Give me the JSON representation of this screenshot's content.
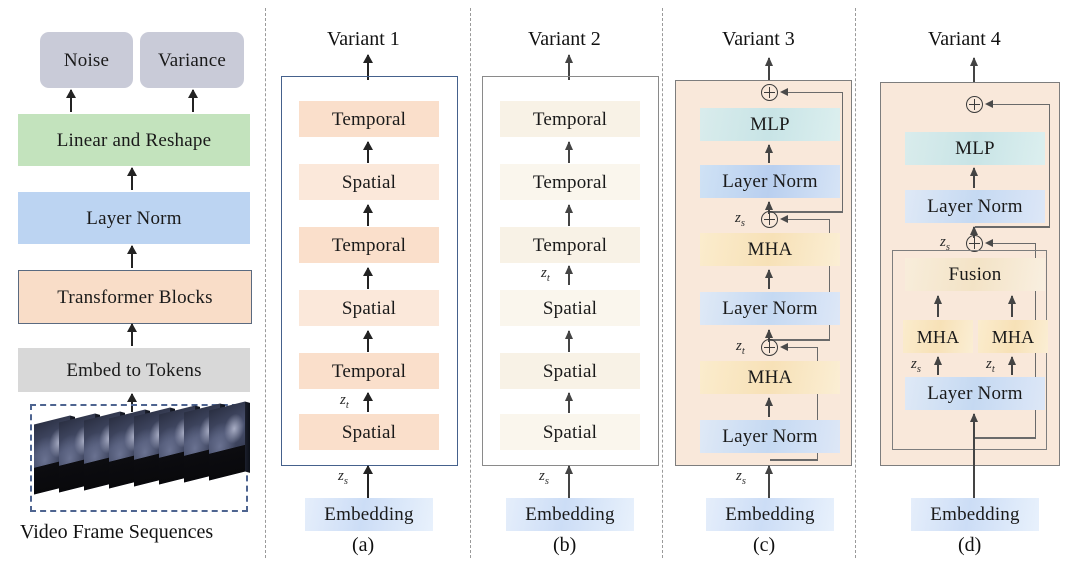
{
  "figure": {
    "left_pipeline": {
      "outputs": [
        {
          "label": "Noise"
        },
        {
          "label": "Variance"
        }
      ],
      "stages": [
        {
          "label": "Linear and Reshape",
          "color": "#c3e3bd"
        },
        {
          "label": "Layer Norm",
          "color": "#bcd4f2"
        },
        {
          "label": "Transformer Blocks",
          "color": "#f9ddc8"
        },
        {
          "label": "Embed to Tokens",
          "color": "#d8d8d8"
        }
      ],
      "input_caption": "Video Frame Sequences",
      "frame_count": 8
    },
    "variants": [
      {
        "title": "Variant 1",
        "caption": "(a)",
        "embedding_label": "Embedding",
        "input_token": "z_s",
        "mid_token": "z_t",
        "border_color": "#45618c",
        "blocks": [
          {
            "label": "Temporal"
          },
          {
            "label": "Spatial"
          },
          {
            "label": "Temporal"
          },
          {
            "label": "Spatial"
          },
          {
            "label": "Temporal"
          },
          {
            "label": "Spatial"
          }
        ]
      },
      {
        "title": "Variant 2",
        "caption": "(b)",
        "embedding_label": "Embedding",
        "input_token": "z_s",
        "mid_token": "z_t",
        "border_color": "#8a8a8a",
        "blocks": [
          {
            "label": "Temporal"
          },
          {
            "label": "Temporal"
          },
          {
            "label": "Temporal"
          },
          {
            "label": "Spatial"
          },
          {
            "label": "Spatial"
          },
          {
            "label": "Spatial"
          }
        ]
      },
      {
        "title": "Variant 3",
        "caption": "(c)",
        "embedding_label": "Embedding",
        "input_token": "z_s",
        "mid_token": "z_t",
        "border_color": "#7d7d7d",
        "panel_fill": "#f9e8da",
        "blocks": [
          {
            "label": "MLP"
          },
          {
            "label": "Layer Norm"
          },
          {
            "label": "MHA"
          },
          {
            "label": "Layer Norm"
          },
          {
            "label": "MHA"
          },
          {
            "label": "Layer Norm"
          }
        ],
        "adders": 3
      },
      {
        "title": "Variant 4",
        "caption": "(d)",
        "embedding_label": "Embedding",
        "input_token": "z_s",
        "mid_token": "z_t",
        "border_color": "#7d7d7d",
        "panel_fill": "#f9e8da",
        "blocks": [
          {
            "label": "MLP"
          },
          {
            "label": "Layer Norm"
          },
          {
            "label": "Fusion"
          },
          {
            "label": "MHA"
          },
          {
            "label": "MHA"
          },
          {
            "label": "Layer Norm"
          }
        ],
        "adders": 2
      }
    ]
  }
}
